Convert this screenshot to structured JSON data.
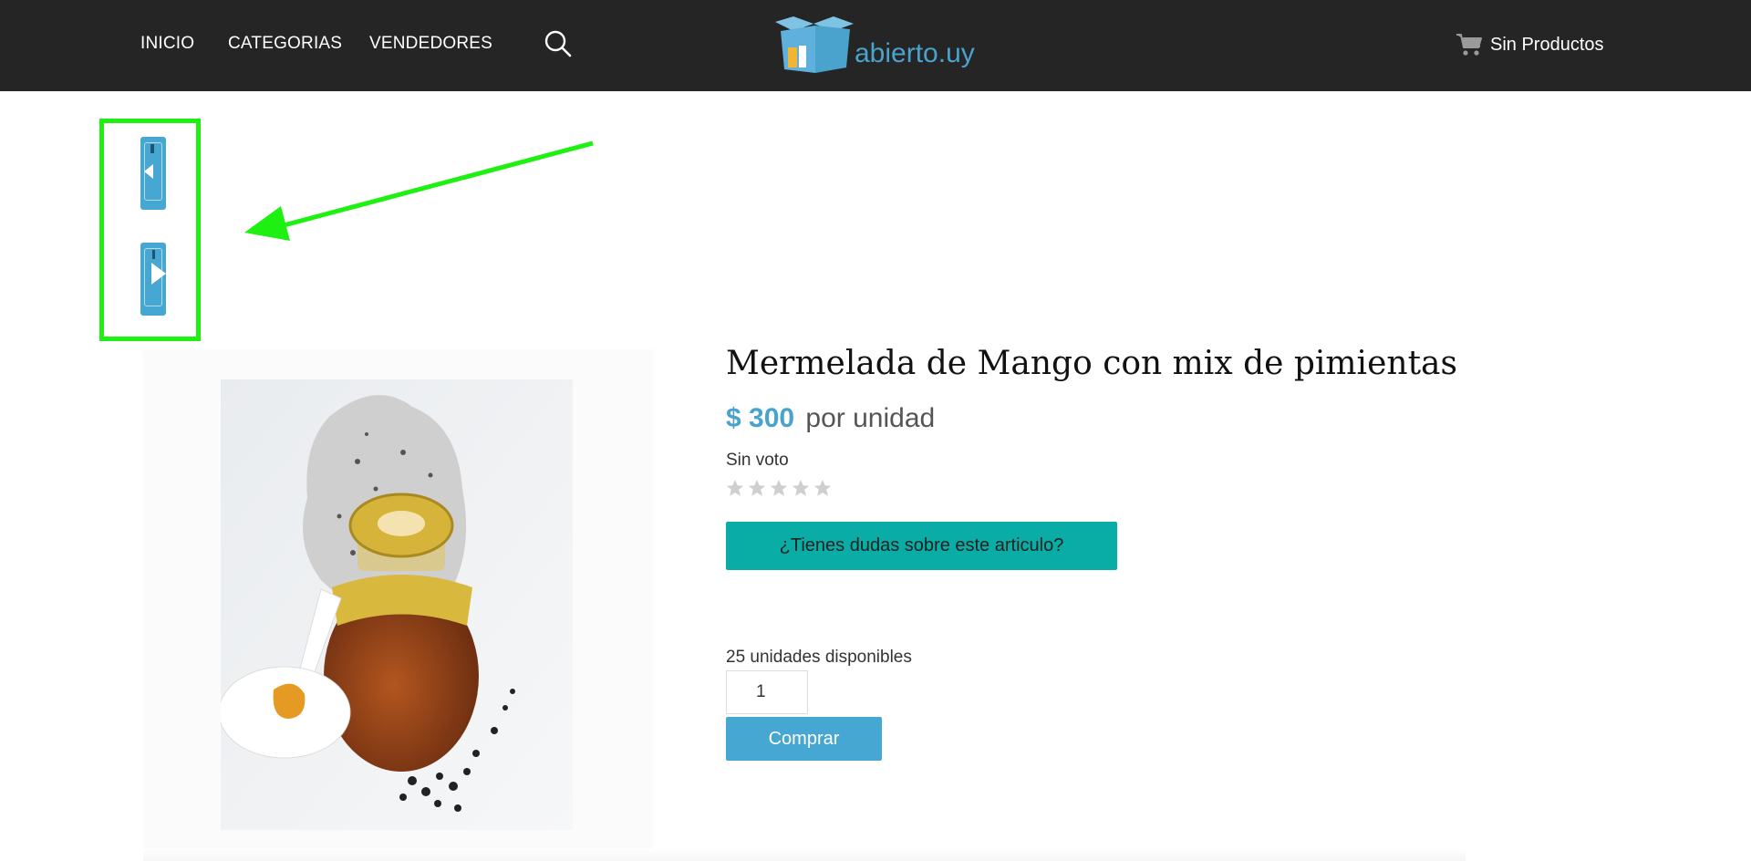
{
  "nav": {
    "items": [
      {
        "label": "INICIO"
      },
      {
        "label": "CATEGORIAS"
      },
      {
        "label": "VENDEDORES"
      }
    ],
    "search_icon": "search-icon"
  },
  "logo": {
    "text": "abierto.uy"
  },
  "cart": {
    "label": "Sin Productos",
    "icon": "cart-icon"
  },
  "gallery": {
    "prev_icon": "arrow-left-icon",
    "next_icon": "arrow-right-icon"
  },
  "product": {
    "title": "Mermelada de Mango con mix de pimientas",
    "price": "$ 300",
    "unit": "por unidad",
    "vote_text": "Sin voto",
    "rating": 0,
    "rating_max": 5,
    "question_button": "¿Tienes dudas sobre este articulo?",
    "availability": "25 unidades disponibles",
    "quantity": "1",
    "buy_button": "Comprar"
  },
  "colors": {
    "topbar": "#252525",
    "accent": "#47a7d3",
    "question_button": "#0aada6",
    "annotation": "#1ef012"
  }
}
